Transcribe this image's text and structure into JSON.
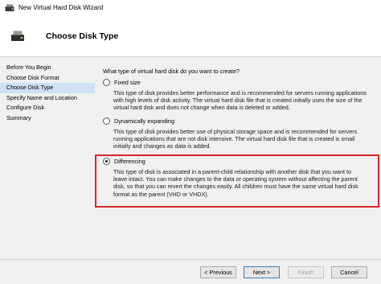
{
  "window": {
    "title": "New Virtual Hard Disk Wizard",
    "icon": "disk-icon"
  },
  "header": {
    "title": "Choose Disk Type",
    "icon": "disk-icon"
  },
  "nav": {
    "items": [
      {
        "label": "Before You Begin"
      },
      {
        "label": "Choose Disk Format"
      },
      {
        "label": "Choose Disk Type",
        "active": true
      },
      {
        "label": "Specify Name and Location"
      },
      {
        "label": "Configure Disk"
      },
      {
        "label": "Summary"
      }
    ]
  },
  "main": {
    "question": "What type of virtual hard disk do you want to create?",
    "options": [
      {
        "label": "Fixed size",
        "selected": false,
        "desc": [
          "This type of disk provides better performance and is recommended for servers running applications",
          "with high levels of disk activity. The virtual hard disk file that is created initially uses the size of the",
          "virtual hard disk and does not change when data is deleted or added."
        ]
      },
      {
        "label": "Dynamically expanding",
        "selected": false,
        "desc": [
          "This type of disk provides better use of physical storage space and is recommended for servers",
          "running applications that are not disk intensive. The virtual hard disk file that is created is small",
          "initially and changes as data is added."
        ]
      },
      {
        "label": "Differencing",
        "selected": true,
        "desc": [
          "This type of disk is associated in a parent-child relationship with another disk that you want to",
          "leave intact. You can make changes to the data or operating system without affecting the parent",
          "disk, so that you can revert the changes easily. All children must have the same virtual hard disk",
          "format as the parent (VHD or VHDX)."
        ]
      }
    ]
  },
  "footer": {
    "previous": "< Previous",
    "next": "Next >",
    "finish": "Finish",
    "cancel": "Cancel"
  },
  "colors": {
    "highlight_border": "#d9252b",
    "nav_active_bg": "#cfe1f3"
  }
}
